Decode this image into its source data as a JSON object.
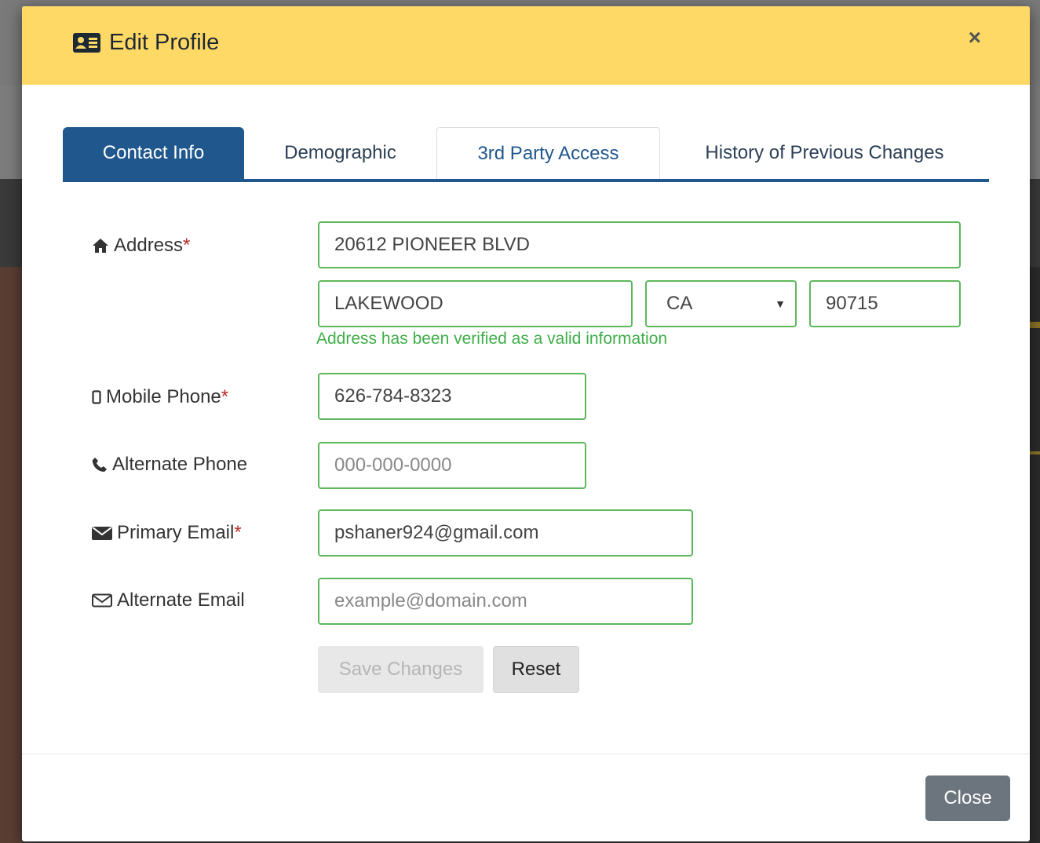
{
  "modal": {
    "title": "Edit Profile",
    "close_glyph": "×",
    "title_icon": "id-card-icon"
  },
  "tabs": [
    {
      "label": "Contact Info",
      "active": true
    },
    {
      "label": "Demographic",
      "active": false
    },
    {
      "label": "3rd Party Access",
      "active": false
    },
    {
      "label": "History of Previous Changes",
      "active": false
    }
  ],
  "form": {
    "address_label": "Address",
    "address_line": "20612 PIONEER BLVD",
    "city": "LAKEWOOD",
    "state": "CA",
    "zip": "90715",
    "address_help": "Address has been verified as a valid information",
    "mobile_label": "Mobile Phone",
    "mobile_value": "626-784-8323",
    "alt_phone_label": "Alternate Phone",
    "alt_phone_placeholder": "000-000-0000",
    "primary_email_label": "Primary Email",
    "primary_email_value": "pshaner924@gmail.com",
    "alt_email_label": "Alternate Email",
    "alt_email_placeholder": "example@domain.com",
    "required_mark": "*"
  },
  "buttons": {
    "save": "Save Changes",
    "reset": "Reset",
    "close": "Close"
  },
  "colors": {
    "header_bg": "#ffd966",
    "tab_active": "#20578d",
    "field_border": "#5cb85c",
    "help_text": "#3fae49",
    "required": "#b92c28"
  }
}
